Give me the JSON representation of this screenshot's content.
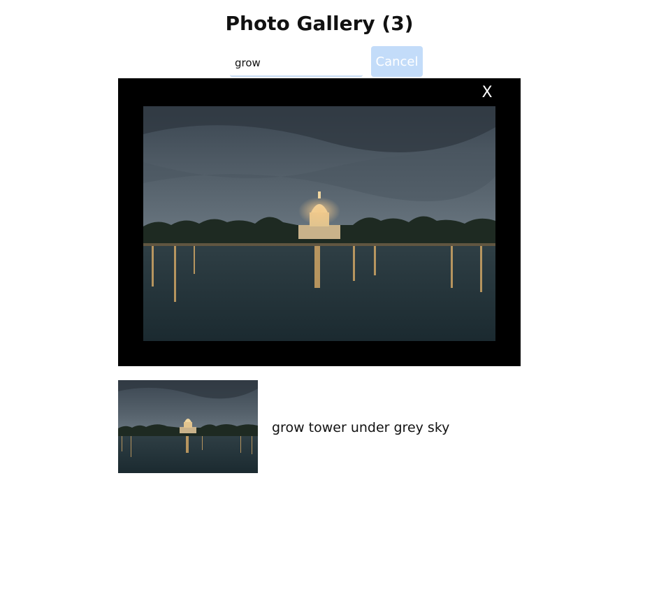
{
  "header": {
    "title": "Photo Gallery (3)"
  },
  "search": {
    "value": "grow",
    "cancel_label": "Cancel"
  },
  "modal": {
    "close_label": "X",
    "photo_icon": "capitol-reflection-photo"
  },
  "results": [
    {
      "caption": "grow tower under grey sky",
      "thumbnail_icon": "capitol-reflection-photo"
    }
  ],
  "colors": {
    "cancel_button_bg": "#c3dcf9",
    "input_underline": "#c8dcf4",
    "modal_bg": "#000000"
  }
}
